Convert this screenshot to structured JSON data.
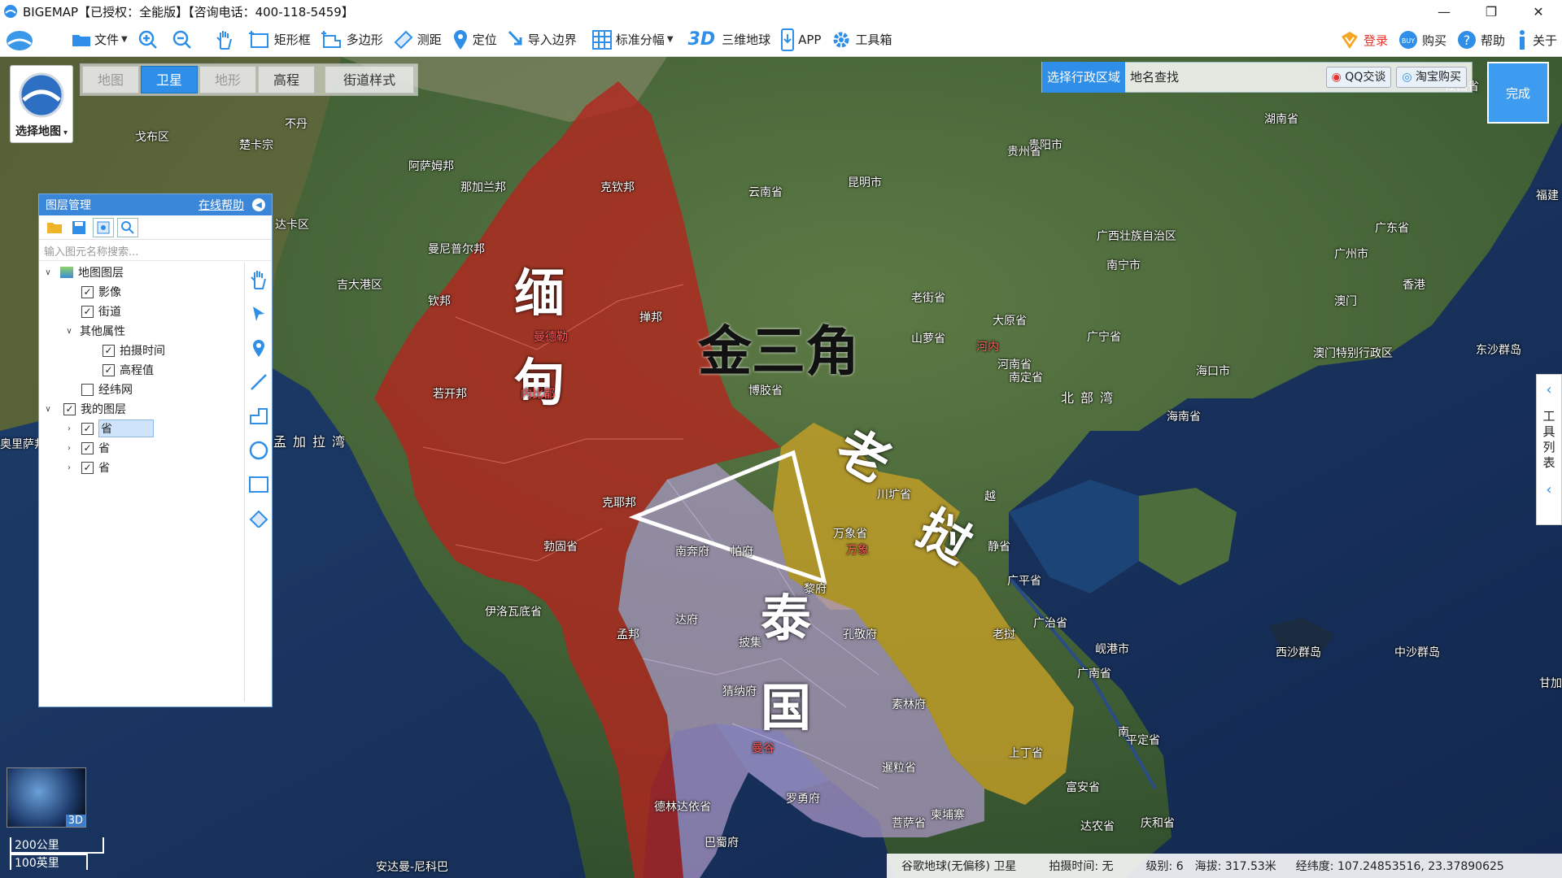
{
  "window": {
    "title": "BIGEMAP【已授权：全能版】【咨询电话：400-118-5459】",
    "controls": [
      "—",
      "❐",
      "✕"
    ]
  },
  "toolbar": {
    "items": [
      {
        "label": "文件",
        "icon": "folder-icon",
        "dropdown": true
      },
      {
        "label": "",
        "icon": "zoom-in-icon"
      },
      {
        "label": "",
        "icon": "zoom-out-icon"
      },
      {
        "label": "",
        "icon": "hand-icon"
      },
      {
        "label": "矩形框",
        "icon": "rectangle-select-icon"
      },
      {
        "label": "多边形",
        "icon": "polygon-select-icon"
      },
      {
        "label": "测距",
        "icon": "ruler-icon"
      },
      {
        "label": "定位",
        "icon": "location-pin-icon"
      },
      {
        "label": "导入边界",
        "icon": "import-icon"
      },
      {
        "label": "标准分幅",
        "icon": "grid-icon",
        "dropdown": true
      },
      {
        "label": "三维地球",
        "icon": "3d-icon"
      },
      {
        "label": "APP",
        "icon": "app-download-icon"
      },
      {
        "label": "工具箱",
        "icon": "gear-icon"
      }
    ],
    "right": [
      {
        "label": "登录",
        "icon": "vip-icon",
        "color": "#e8322a"
      },
      {
        "label": "购买",
        "icon": "buy-icon"
      },
      {
        "label": "帮助",
        "icon": "help-icon"
      },
      {
        "label": "关于",
        "icon": "info-icon"
      }
    ],
    "three_d_glyph": "3D"
  },
  "map_selector": {
    "label": "选择地图",
    "icon": "google-earth-icon"
  },
  "map_tabs": [
    {
      "label": "地图",
      "active": false,
      "dim": true
    },
    {
      "label": "卫星",
      "active": true,
      "dim": false
    },
    {
      "label": "地形",
      "active": false,
      "dim": true
    },
    {
      "label": "高程",
      "active": false,
      "dim": false
    },
    {
      "label": "街道样式",
      "active": false,
      "dim": false
    }
  ],
  "right_search": {
    "tabs": [
      {
        "label": "选择行政区域",
        "active": true
      },
      {
        "label": "地名查找",
        "active": false
      }
    ],
    "buttons": [
      "QQ交谈",
      "淘宝购买"
    ],
    "done": "完成"
  },
  "layer_panel": {
    "title": "图层管理",
    "help": "在线帮助",
    "search_placeholder": "输入图元名称搜索...",
    "tree": [
      {
        "label": "地图图层",
        "level": 0,
        "arrow": "v",
        "checkbox": false,
        "icon": true
      },
      {
        "label": "影像",
        "level": 1,
        "checked": true
      },
      {
        "label": "街道",
        "level": 1,
        "checked": true
      },
      {
        "label": "其他属性",
        "level": 1,
        "arrow": "v",
        "checkbox": false
      },
      {
        "label": "拍摄时间",
        "level": 2,
        "checked": true
      },
      {
        "label": "高程值",
        "level": 2,
        "checked": true
      },
      {
        "label": "经纬网",
        "level": 1,
        "checked": false
      },
      {
        "label": "我的图层",
        "level": 0,
        "arrow": "v",
        "checked": true
      },
      {
        "label": "省",
        "level": 1,
        "arrow": ">",
        "checked": true,
        "selected": true
      },
      {
        "label": "省",
        "level": 1,
        "arrow": ">",
        "checked": true
      },
      {
        "label": "省",
        "level": 1,
        "arrow": ">",
        "checked": true
      }
    ]
  },
  "tool_list": {
    "label": "工具列表"
  },
  "overlay": {
    "myanmar": [
      "缅",
      "甸"
    ],
    "golden_triangle": "金三角",
    "laos": [
      "老",
      "挝"
    ],
    "thailand": [
      "泰",
      "国"
    ]
  },
  "place_labels": [
    {
      "text": "不丹"
    },
    {
      "text": "戈布区"
    },
    {
      "text": "楚卡宗"
    },
    {
      "text": "阿萨姆邦"
    },
    {
      "text": "那加兰邦"
    },
    {
      "text": "曼尼普尔邦"
    },
    {
      "text": "达卡区"
    },
    {
      "text": "吉大港区"
    },
    {
      "text": "克钦邦"
    },
    {
      "text": "云南省"
    },
    {
      "text": "昆明市"
    },
    {
      "text": "贵阳市"
    },
    {
      "text": "贵州省"
    },
    {
      "text": "湖南省"
    },
    {
      "text": "江西省"
    },
    {
      "text": "广西壮族自治区"
    },
    {
      "text": "南宁市"
    },
    {
      "text": "广东省"
    },
    {
      "text": "广州市"
    },
    {
      "text": "香港"
    },
    {
      "text": "澳门"
    },
    {
      "text": "澳门特别行政区"
    },
    {
      "text": "老街省"
    },
    {
      "text": "大原省"
    },
    {
      "text": "山萝省"
    },
    {
      "text": "广宁省"
    },
    {
      "text": "河内"
    },
    {
      "text": "河南省"
    },
    {
      "text": "南定省"
    },
    {
      "text": "海口市"
    },
    {
      "text": "海南省"
    },
    {
      "text": "北部湾"
    },
    {
      "text": "东沙群岛"
    },
    {
      "text": "掸邦"
    },
    {
      "text": "曼德勒"
    },
    {
      "text": "钦邦"
    },
    {
      "text": "若开邦"
    },
    {
      "text": "内比都"
    },
    {
      "text": "克耶邦"
    },
    {
      "text": "勃固省"
    },
    {
      "text": "伊洛瓦底省"
    },
    {
      "text": "孟邦"
    },
    {
      "text": "博胶省"
    },
    {
      "text": "川圹省"
    },
    {
      "text": "万象省"
    },
    {
      "text": "万象"
    },
    {
      "text": "孟加拉湾"
    },
    {
      "text": "南奔府"
    },
    {
      "text": "帕府"
    },
    {
      "text": "达府"
    },
    {
      "text": "孔敬府"
    },
    {
      "text": "黎府"
    },
    {
      "text": "披集"
    },
    {
      "text": "猜纳府"
    },
    {
      "text": "素林府"
    },
    {
      "text": "曼谷"
    },
    {
      "text": "罗勇府"
    },
    {
      "text": "暹粒省"
    },
    {
      "text": "柬埔寨"
    },
    {
      "text": "菩萨省"
    },
    {
      "text": "上丁省"
    },
    {
      "text": "富安省"
    },
    {
      "text": "广南省"
    },
    {
      "text": "岘港市"
    },
    {
      "text": "广治省"
    },
    {
      "text": "西沙群岛"
    },
    {
      "text": "中沙群岛"
    },
    {
      "text": "平定省"
    },
    {
      "text": "达农省"
    },
    {
      "text": "庆和省"
    },
    {
      "text": "德林达依省"
    },
    {
      "text": "巴蜀府"
    },
    {
      "text": "安达曼-尼科巴"
    },
    {
      "text": "奥里萨邦"
    },
    {
      "text": "福建"
    },
    {
      "text": "越"
    },
    {
      "text": "南"
    },
    {
      "text": "广平省"
    },
    {
      "text": "静省"
    },
    {
      "text": "老挝"
    },
    {
      "text": "甘加"
    }
  ],
  "scale": {
    "km": "200公里",
    "mi": "100英里"
  },
  "minimap": {
    "label": "3D"
  },
  "status": {
    "source": "谷歌地球(无偏移) 卫星",
    "shot_time": "拍摄时间: 无",
    "level": "级别: 6",
    "altitude": "海拔: 317.53米",
    "coords": "经纬度: 107.24853516, 23.37890625"
  },
  "colors": {
    "accent": "#2f8fe8",
    "myanmar": "#c0392b",
    "laos": "#c9a227",
    "thailand": "#b39bc8"
  }
}
